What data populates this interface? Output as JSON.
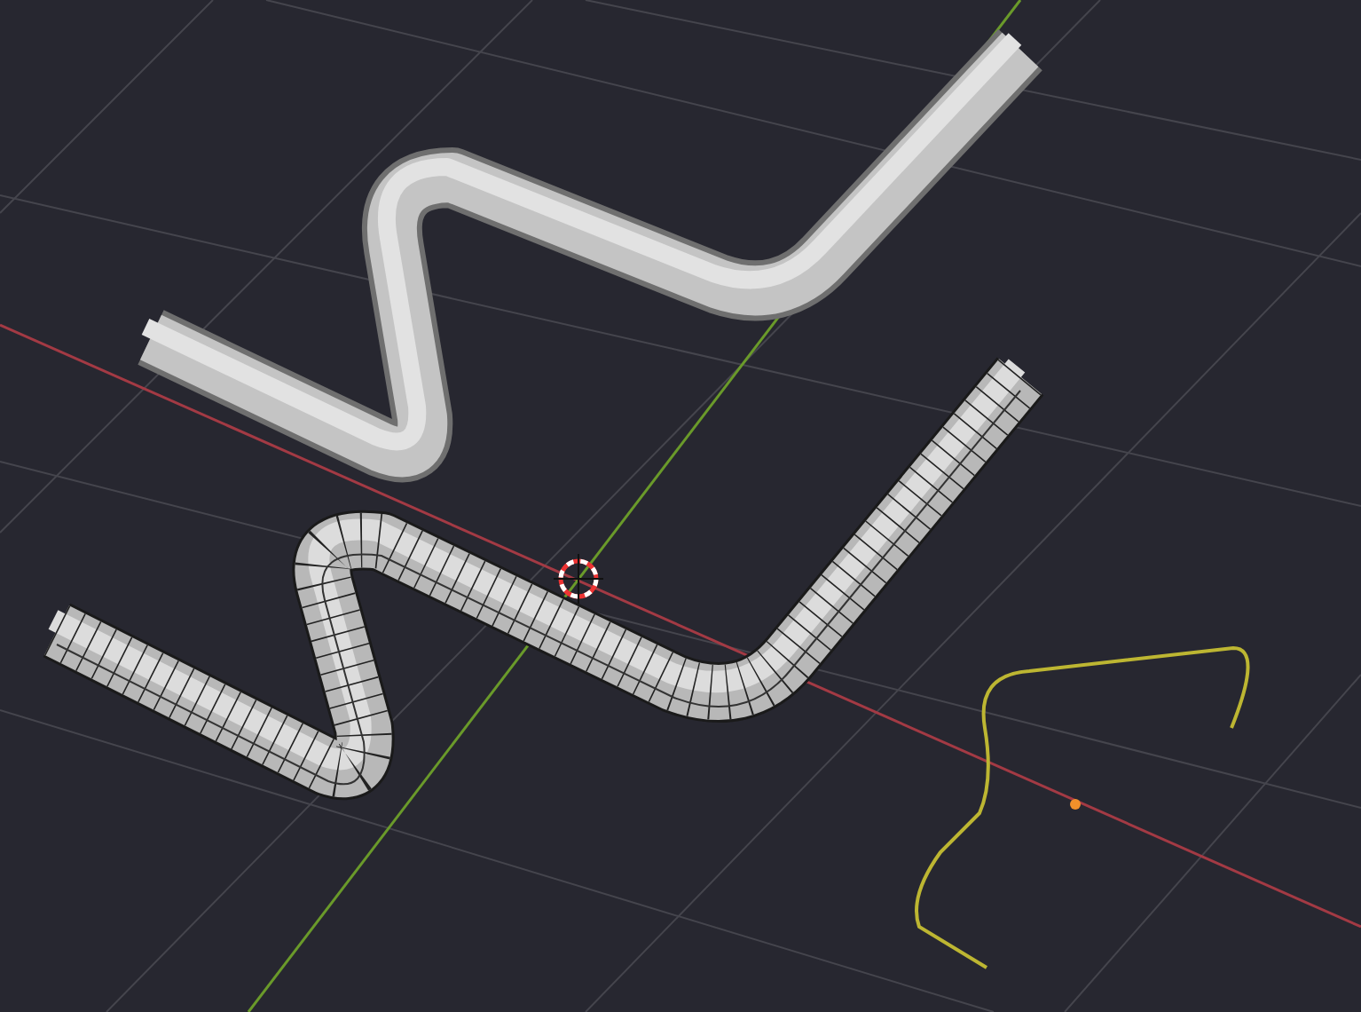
{
  "viewport": {
    "objects": [
      {
        "kind": "solid-mesh"
      },
      {
        "kind": "wire-mesh"
      },
      {
        "kind": "curve"
      },
      {
        "kind": "cursor"
      },
      {
        "kind": "origin"
      }
    ]
  }
}
